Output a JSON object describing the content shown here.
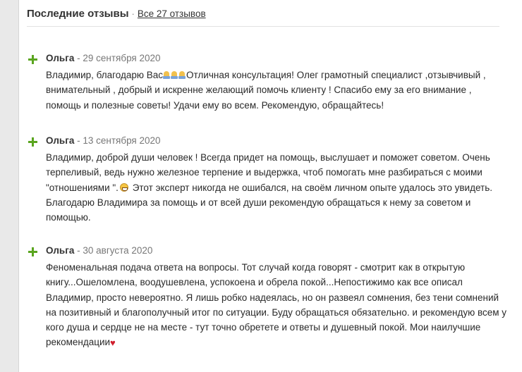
{
  "header": {
    "title": "Последние отзывы",
    "separator": "·",
    "all_reviews_link": "Все 27 отзывов"
  },
  "reviews": [
    {
      "author": "Ольга",
      "dash": "-",
      "date": "29 сентября 2020",
      "text_1": "Владимир, благодарю Вас",
      "emoji_icons": [
        "folded-hands-icon",
        "folded-hands-icon",
        "folded-hands-icon"
      ],
      "text_2": "Отличная консультация! Олег грамотный специалист ,отзывчивый , внимательный , добрый и искренне желающий помочь клиенту ! Спасибо ему за его внимание , помощь и полезные советы! Удачи ему во всем. Рекомендую, обращайтесь!"
    },
    {
      "author": "Ольга",
      "dash": "-",
      "date": "13 сентября 2020",
      "text_1": "Владимир, доброй души человек ! Всегда придет на помощь, выслушает и поможет советом. Очень терпеливый, ведь нужно железное терпение и выдержка, чтоб помогать мне разбираться с моими \"отношениями \".",
      "emoji_icons": [
        "grinning-face-icon"
      ],
      "text_2": "Этот эксперт никогда не ошибался, на своём личном опыте удалось это увидеть. Благодарю Владимира за помощь и от всей души рекомендую обращаться к нему за советом и помощью."
    },
    {
      "author": "Ольга",
      "dash": "-",
      "date": "30 августа 2020",
      "text_1": "Феноменальная подача ответа на вопросы. Тот случай когда говорят - смотрит как в открытую книгу...Ошеломлена, воодушевлена, успокоена и обрела покой...Непостижимо как все описал Владимир, просто невероятно. Я лишь робко надеялась, но он развеял сомнения, без тени сомнений на позитивный и благополучный итог по ситуации. Буду обращаться обязательно. и рекомендую всем у кого душа и сердце не на месте - тут точно обретете и ответы и душевный покой. Мои наилучшие рекомендации",
      "emoji_icons": [
        "red-heart-icon"
      ],
      "text_2": ""
    }
  ],
  "colors": {
    "accent_green": "#5aa51f",
    "page_background": "#e9e9e9",
    "panel_background": "#ffffff"
  }
}
